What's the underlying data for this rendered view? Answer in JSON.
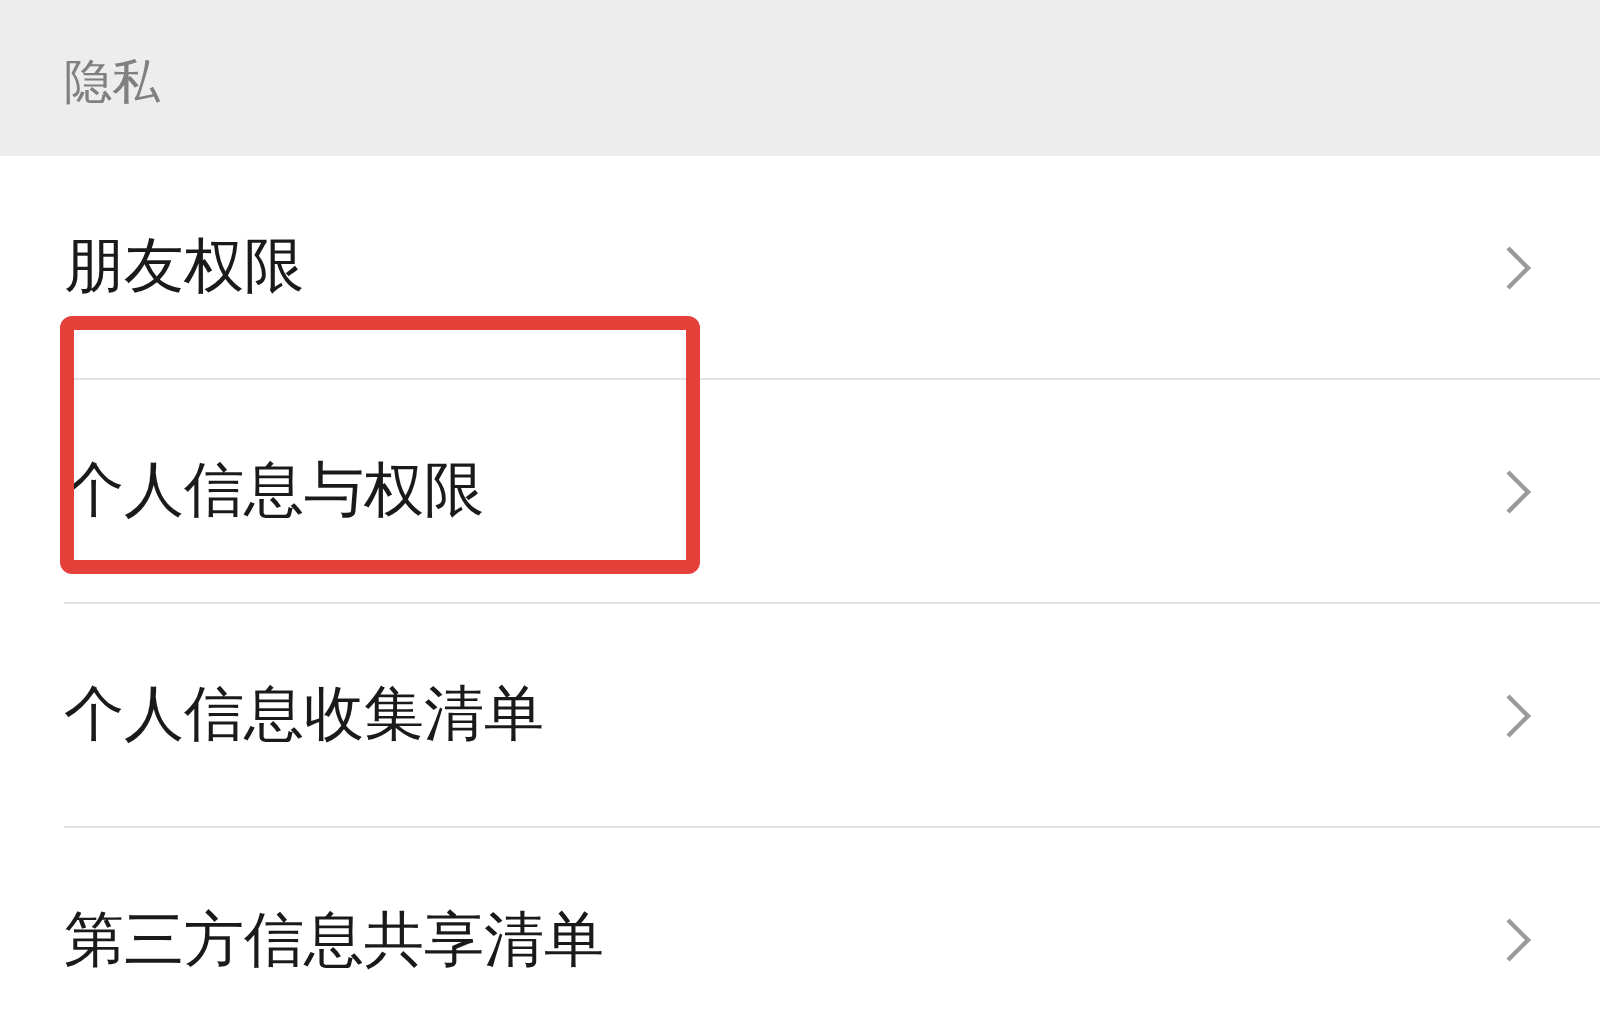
{
  "section_header": "隐私",
  "items": [
    {
      "label": "朋友权限",
      "highlighted": false
    },
    {
      "label": "个人信息与权限",
      "highlighted": true
    },
    {
      "label": "个人信息收集清单",
      "highlighted": false
    },
    {
      "label": "第三方信息共享清单",
      "highlighted": false
    }
  ]
}
